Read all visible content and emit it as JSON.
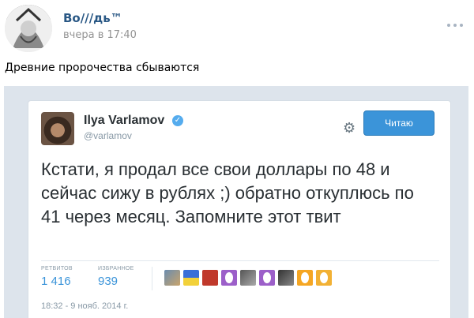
{
  "post": {
    "author": "Во///дь™",
    "time": "вчера в 17:40",
    "text": "Древние пророчества сбываются"
  },
  "tweet": {
    "name": "Ilya Varlamov",
    "handle": "@varlamov",
    "follow_label": "Читаю",
    "body": "Кстати, я продал все свои доллары по 48 и сейчас сижу в рублях ;) обратно откуплюсь по 41 через месяц. Запомните этот твит",
    "retweets_label": "РЕТВИТОВ",
    "retweets": "1 416",
    "favorites_label": "ИЗБРАННОЕ",
    "favorites": "939",
    "date": "18:32 - 9 нояб. 2014 г."
  },
  "icons": {
    "more": "more-dots-icon",
    "verified": "verified-badge-icon",
    "settings": "gear-icon"
  },
  "colors": {
    "author_link": "#2a5885",
    "twitter_blue": "#3b94d9",
    "egg_purple": "#9c5fc9",
    "egg_orange": "#f5a623"
  }
}
